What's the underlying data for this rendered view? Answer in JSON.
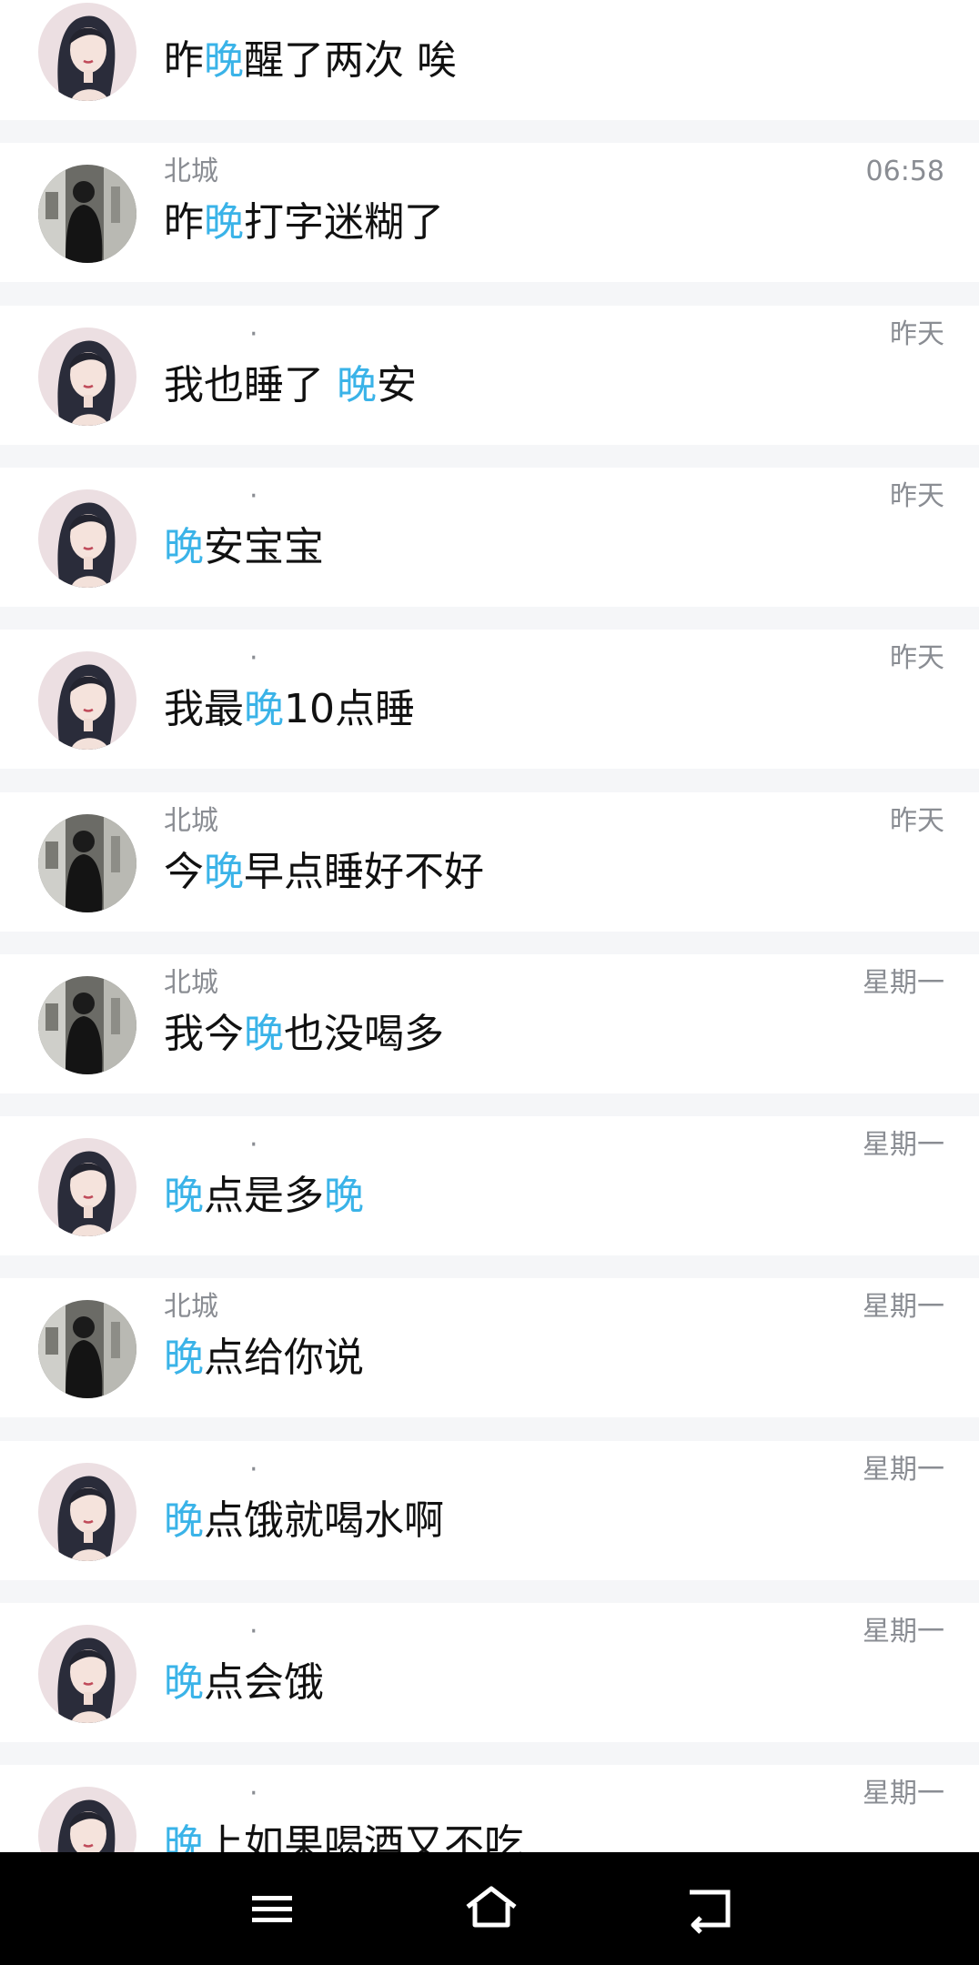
{
  "messages": [
    {
      "avatar": "girl",
      "sender": "",
      "time": "",
      "parts": [
        [
          "昨",
          false
        ],
        [
          "晚",
          true
        ],
        [
          "醒了两次  唉",
          false
        ]
      ]
    },
    {
      "avatar": "boy",
      "sender": "北城",
      "time": "06:58",
      "parts": [
        [
          "昨",
          false
        ],
        [
          "晚",
          true
        ],
        [
          "打字迷糊了",
          false
        ]
      ]
    },
    {
      "avatar": "girl",
      "sender": "·",
      "time": "昨天",
      "parts": [
        [
          "我也睡了 ",
          false
        ],
        [
          "晚",
          true
        ],
        [
          "安",
          false
        ]
      ]
    },
    {
      "avatar": "girl",
      "sender": "·",
      "time": "昨天",
      "parts": [
        [
          "晚",
          true
        ],
        [
          "安宝宝",
          false
        ]
      ]
    },
    {
      "avatar": "girl",
      "sender": "·",
      "time": "昨天",
      "parts": [
        [
          "我最",
          false
        ],
        [
          "晚",
          true
        ],
        [
          "10点睡",
          false
        ]
      ]
    },
    {
      "avatar": "boy",
      "sender": "北城",
      "time": "昨天",
      "parts": [
        [
          "今",
          false
        ],
        [
          "晚",
          true
        ],
        [
          "早点睡好不好",
          false
        ]
      ]
    },
    {
      "avatar": "boy",
      "sender": "北城",
      "time": "星期一",
      "parts": [
        [
          "我今",
          false
        ],
        [
          "晚",
          true
        ],
        [
          "也没喝多",
          false
        ]
      ]
    },
    {
      "avatar": "girl",
      "sender": "·",
      "time": "星期一",
      "parts": [
        [
          "晚",
          true
        ],
        [
          "点是多",
          false
        ],
        [
          "晚",
          true
        ]
      ]
    },
    {
      "avatar": "boy",
      "sender": "北城",
      "time": "星期一",
      "parts": [
        [
          "晚",
          true
        ],
        [
          "点给你说",
          false
        ]
      ]
    },
    {
      "avatar": "girl",
      "sender": "·",
      "time": "星期一",
      "parts": [
        [
          "晚",
          true
        ],
        [
          "点饿就喝水啊",
          false
        ]
      ]
    },
    {
      "avatar": "girl",
      "sender": "·",
      "time": "星期一",
      "parts": [
        [
          "晚",
          true
        ],
        [
          "点会饿",
          false
        ]
      ]
    },
    {
      "avatar": "girl",
      "sender": "·",
      "time": "星期一",
      "parts": [
        [
          "晚",
          true
        ],
        [
          "上如果喝酒又不吃",
          false
        ]
      ]
    }
  ],
  "navbar": {
    "menu_icon": "menu-icon",
    "home_icon": "home-icon",
    "back_icon": "back-icon"
  },
  "colors": {
    "highlight": "#3ab3e8",
    "text": "#111111",
    "meta": "#8a8d93",
    "separator": "#f5f6f8"
  }
}
